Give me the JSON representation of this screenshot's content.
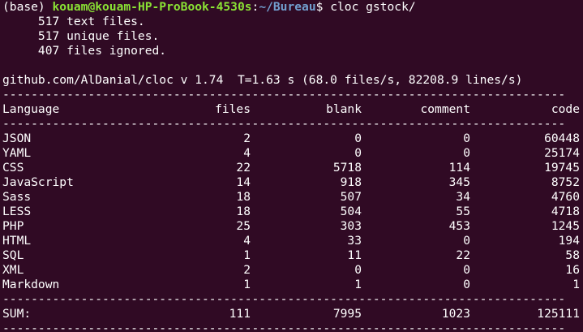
{
  "prompt": {
    "env": "(base)",
    "user_host": "kouam@kouam-HP-ProBook-4530s",
    "colon": ":",
    "path": "~/Bureau",
    "dollar": "$",
    "command": "cloc gstock/"
  },
  "summary": [
    "     517 text files.",
    "     517 unique files.",
    "     407 files ignored."
  ],
  "version_line": "github.com/AlDanial/cloc v 1.74  T=1.63 s (68.0 files/s, 82208.9 lines/s)",
  "separator": "-------------------------------------------------------------------------------",
  "headers": {
    "language": "Language",
    "files": "files",
    "blank": "blank",
    "comment": "comment",
    "code": "code"
  },
  "rows": [
    {
      "language": "JSON",
      "files": "2",
      "blank": "0",
      "comment": "0",
      "code": "60448"
    },
    {
      "language": "YAML",
      "files": "4",
      "blank": "0",
      "comment": "0",
      "code": "25174"
    },
    {
      "language": "CSS",
      "files": "22",
      "blank": "5718",
      "comment": "114",
      "code": "19745"
    },
    {
      "language": "JavaScript",
      "files": "14",
      "blank": "918",
      "comment": "345",
      "code": "8752"
    },
    {
      "language": "Sass",
      "files": "18",
      "blank": "507",
      "comment": "34",
      "code": "4760"
    },
    {
      "language": "LESS",
      "files": "18",
      "blank": "504",
      "comment": "55",
      "code": "4718"
    },
    {
      "language": "PHP",
      "files": "25",
      "blank": "303",
      "comment": "453",
      "code": "1245"
    },
    {
      "language": "HTML",
      "files": "4",
      "blank": "33",
      "comment": "0",
      "code": "194"
    },
    {
      "language": "SQL",
      "files": "1",
      "blank": "11",
      "comment": "22",
      "code": "58"
    },
    {
      "language": "XML",
      "files": "2",
      "blank": "0",
      "comment": "0",
      "code": "16"
    },
    {
      "language": "Markdown",
      "files": "1",
      "blank": "1",
      "comment": "0",
      "code": "1"
    }
  ],
  "sum": {
    "language": "SUM:",
    "files": "111",
    "blank": "7995",
    "comment": "1023",
    "code": "125111"
  },
  "colors": {
    "background": "#300a24",
    "text": "#ffffff",
    "user_host": "#8ae234",
    "path": "#729fcf"
  }
}
